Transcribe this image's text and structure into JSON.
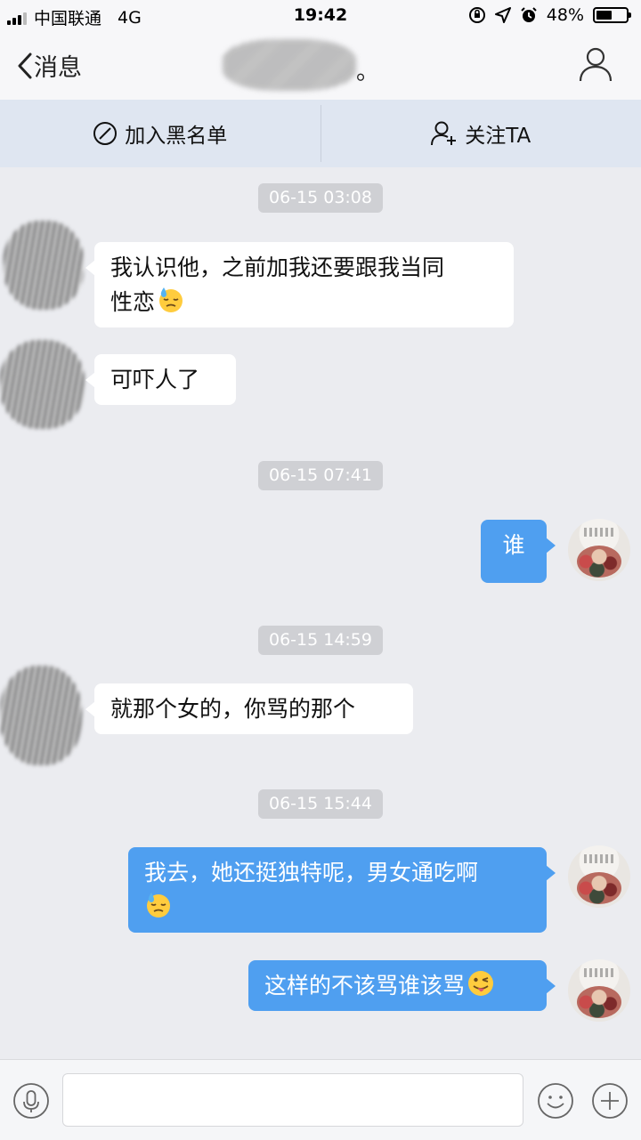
{
  "status_bar": {
    "carrier": "中国联通",
    "network": "4G",
    "time": "19:42",
    "battery": "48%",
    "battery_level": 0.48
  },
  "nav": {
    "back_label": "消息",
    "title_suffix": "。"
  },
  "actions": {
    "blacklist_label": "加入黑名单",
    "follow_label": "关注TA"
  },
  "timestamps": [
    "06-15 03:08",
    "06-15 07:41",
    "06-15 14:59",
    "06-15 15:44"
  ],
  "messages": [
    {
      "side": "in",
      "text": "我认识他，之前加我还要跟我当同",
      "text2": "性恋",
      "emoji": "downcast-sweat-face"
    },
    {
      "side": "in",
      "text": "可吓人了"
    },
    {
      "side": "out",
      "text": "谁"
    },
    {
      "side": "in",
      "text": "就那个女的，你骂的那个"
    },
    {
      "side": "out",
      "text": "我去，她还挺独特呢，男女通吃啊",
      "emoji": "downcast-sweat-face"
    },
    {
      "side": "out",
      "text": "这样的不该骂谁该骂",
      "emoji": "winking-tongue-face"
    }
  ],
  "input": {
    "placeholder": ""
  },
  "colors": {
    "background": "#ebecf0",
    "outgoing_bubble": "#4f9ff0",
    "incoming_bubble": "#ffffff",
    "action_bar": "#dfe6f1"
  }
}
